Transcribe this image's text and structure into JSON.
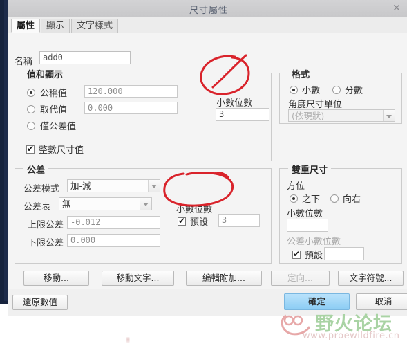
{
  "window": {
    "title": "尺寸屬性",
    "close_label": "✕"
  },
  "tabs": [
    {
      "label": "屬性",
      "active": true
    },
    {
      "label": "顯示",
      "active": false
    },
    {
      "label": "文字樣式",
      "active": false
    }
  ],
  "name_row": {
    "label": "名稱",
    "value": "add0"
  },
  "values_group": {
    "legend": "值和顯示",
    "radios": [
      {
        "label": "公稱值",
        "selected": true,
        "value": "120.000"
      },
      {
        "label": "取代值",
        "selected": false,
        "value": "0.000"
      },
      {
        "label": "僅公差值",
        "selected": false,
        "value": ""
      }
    ],
    "integer_checkbox": {
      "label": "整數尺寸值",
      "checked": true
    },
    "decimal_places": {
      "label": "小數位數",
      "value": "3"
    }
  },
  "tolerance_group": {
    "legend": "公差",
    "mode_label": "公差模式",
    "mode_value": "加-減",
    "table_label": "公差表",
    "table_value": "無",
    "upper_label": "上限公差",
    "upper_value": "-0.012",
    "lower_label": "下限公差",
    "lower_value": "0.000",
    "decimal_places": {
      "label": "小數位數",
      "default_label": "預設",
      "default_checked": true,
      "value": "3"
    }
  },
  "format_group": {
    "legend": "格式",
    "radios": [
      {
        "label": "小數",
        "selected": true
      },
      {
        "label": "分數",
        "selected": false
      }
    ],
    "angular_label": "角度尺寸單位",
    "angular_value": "(依現狀)"
  },
  "dual_group": {
    "legend": "雙重尺寸",
    "position_label": "方位",
    "radios": [
      {
        "label": "之下",
        "selected": true
      },
      {
        "label": "向右",
        "selected": false
      }
    ],
    "decimal_places_label": "小數位數",
    "decimal_places_value": "",
    "tol_decimal_label": "公差小數位數",
    "tol_default_label": "預設",
    "tol_default_checked": true,
    "tol_default_value": ""
  },
  "buttons": {
    "move": "移動...",
    "move_text": "移動文字...",
    "edit_attach": "編輯附加...",
    "orient": "定向...",
    "text_symbol": "文字符號...",
    "restore": "還原數值",
    "ok": "確定",
    "cancel": "取消"
  },
  "annotations": {
    "top_circle": "小數位數",
    "bottom_circle": "預設 小數位數",
    "color": "#d9232b"
  },
  "watermark": {
    "text": "野火论坛",
    "url": "www.proewildfire.cn",
    "text_color": "#a9d3a4",
    "url_color": "#e3c6c6"
  }
}
